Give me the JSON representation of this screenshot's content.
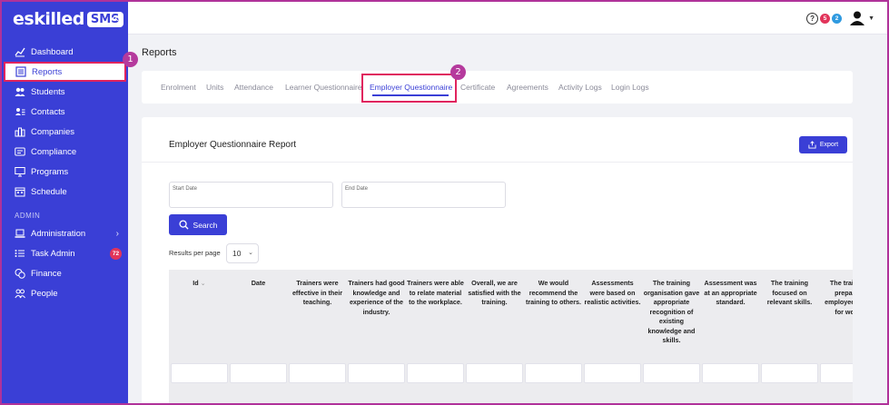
{
  "brand": {
    "name": "eskilled",
    "badge": "SMS"
  },
  "sidebar": {
    "items": [
      {
        "label": "Dashboard",
        "icon": "chart-line-icon"
      },
      {
        "label": "Reports",
        "icon": "report-icon"
      },
      {
        "label": "Students",
        "icon": "users-icon"
      },
      {
        "label": "Contacts",
        "icon": "contact-card-icon"
      },
      {
        "label": "Companies",
        "icon": "building-icon"
      },
      {
        "label": "Compliance",
        "icon": "id-card-icon"
      },
      {
        "label": "Programs",
        "icon": "monitor-icon"
      },
      {
        "label": "Schedule",
        "icon": "calendar-icon"
      }
    ],
    "admin_label": "ADMIN",
    "admin_items": [
      {
        "label": "Administration",
        "icon": "laptop-icon"
      },
      {
        "label": "Task Admin",
        "icon": "list-icon",
        "badge": "72"
      },
      {
        "label": "Finance",
        "icon": "coins-icon"
      },
      {
        "label": "People",
        "icon": "people-icon"
      }
    ]
  },
  "topbar": {
    "help": "?",
    "badge_red": "5",
    "badge_blue": "2"
  },
  "callouts": {
    "one": "1",
    "two": "2"
  },
  "page_title": "Reports",
  "tabs": [
    "Enrolment",
    "Units",
    "Attendance",
    "Learner Questionnaire",
    "Employer Questionnaire",
    "Certificate",
    "Agreements",
    "Activity Logs",
    "Login Logs"
  ],
  "report": {
    "title": "Employer Questionnaire Report",
    "export_label": "Export",
    "start_date_label": "Start Date",
    "end_date_label": "End Date",
    "search_label": "Search",
    "rpp_label": "Results per page",
    "rpp_value": "10",
    "columns": [
      "Id",
      "Date",
      "Trainers were effective in their teaching.",
      "Trainers had good knowledge and experience of the industry.",
      "Trainers were able to relate material to the workplace.",
      "Overall, we are satisfied with the training.",
      "We would recommend the training to others.",
      "Assessments were based on realistic activities.",
      "The training organisation gave appropriate recognition of existing knowledge and skills.",
      "Assessment was at an appropriate standard.",
      "The training focused on relevant skills.",
      "The training prepared employees well for work."
    ]
  },
  "colors": {
    "primary": "#3a3fd6",
    "highlight": "#e0245e",
    "callout": "#b53a9d"
  }
}
